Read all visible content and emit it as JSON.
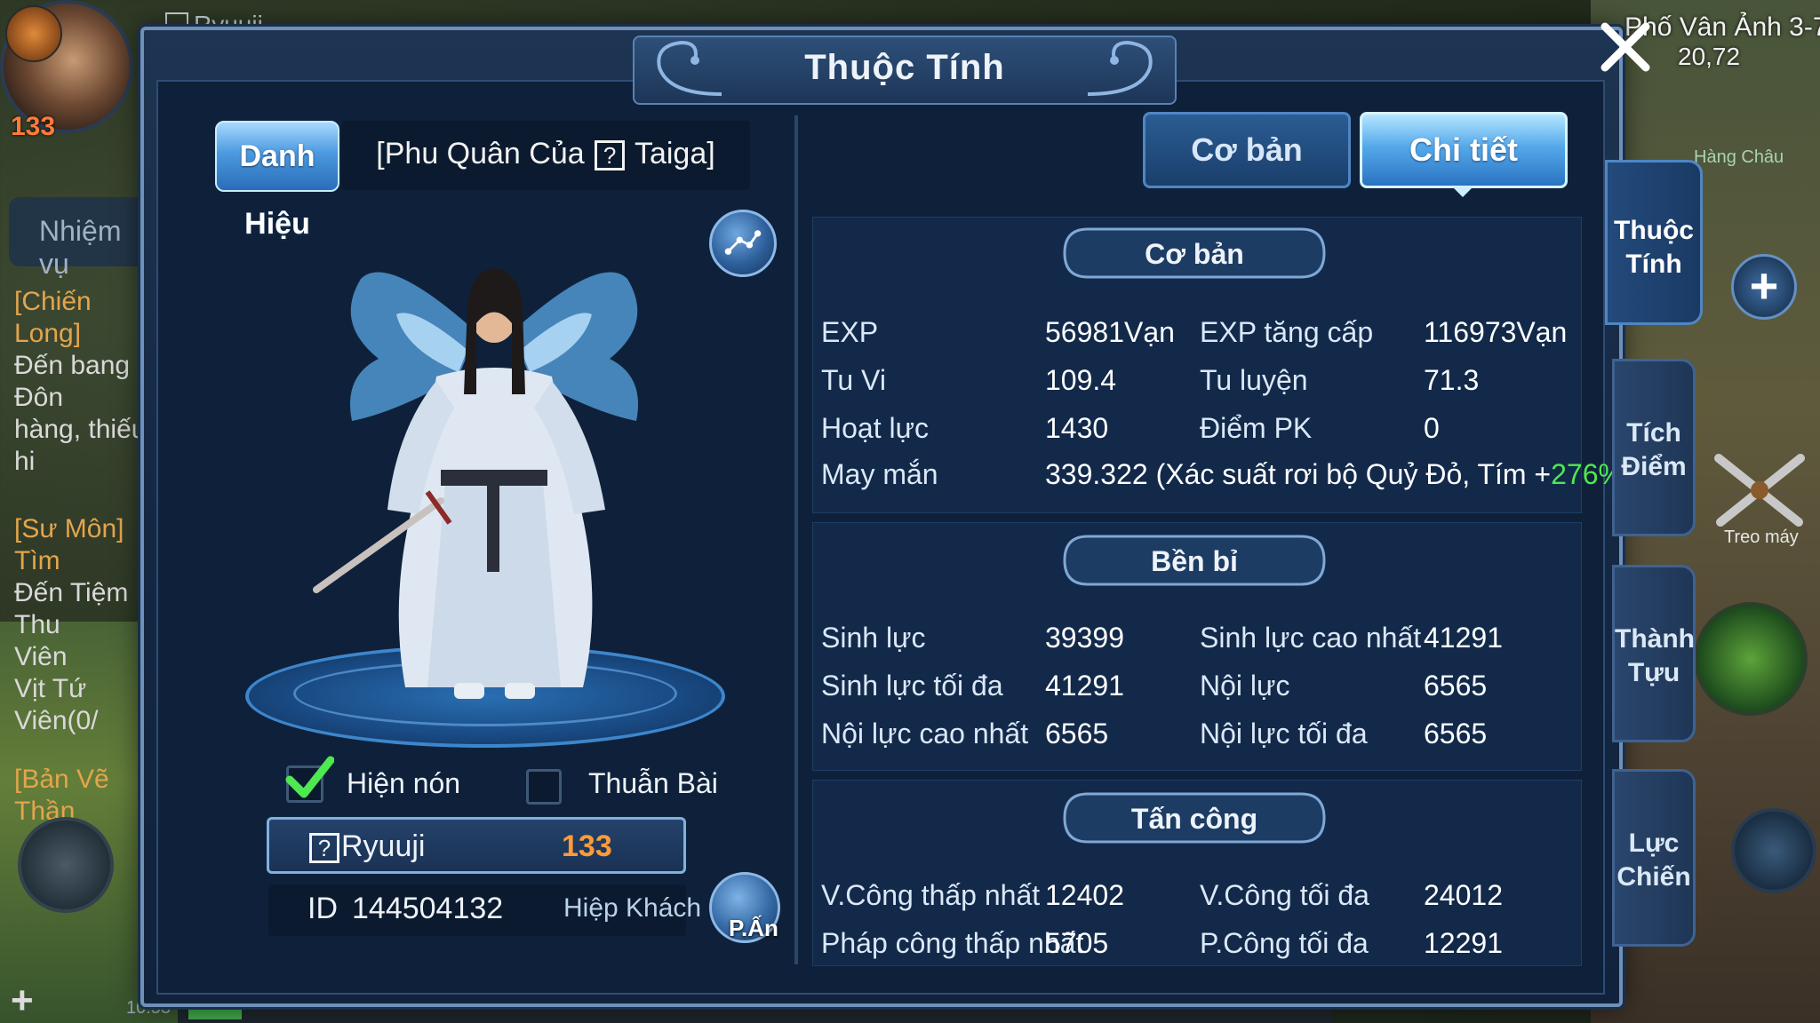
{
  "hud": {
    "player_name": "Ryuuji",
    "player_level": "133",
    "quest_tab": "Nhiệm vụ",
    "quests": [
      {
        "title": "[Chiến Long]",
        "lines": [
          "Đến bang Đôn",
          "hàng, thiếu hi"
        ]
      },
      {
        "title": "[Sư Môn] Tìm",
        "lines": [
          "Đến Tiệm Thu",
          "Viên",
          "Vịt Tứ Viên(0/"
        ]
      },
      {
        "title": "[Bản Vẽ Thần",
        "lines": []
      }
    ],
    "map_name": "Phố Vân Ảnh 3-7",
    "map_coords": "20,72",
    "town_label": "Hàng Châu",
    "treo_may": "Treo máy",
    "clock": "10:53"
  },
  "dialog": {
    "title": "Thuộc Tính",
    "left": {
      "title_tag": "Danh Hiệu",
      "title_name_prefix": "[Phu Quân Của",
      "title_name_box": "?",
      "title_name_suffix": "Taiga]",
      "toggle_hat_label": "Hiện nón",
      "toggle_hat_checked": true,
      "toggle_shield_label": "Thuẫn Bài",
      "toggle_shield_checked": false,
      "name_box": "?",
      "name": "Ryuuji",
      "level": "133",
      "id_label": "ID",
      "id_value": "144504132",
      "class_name": "Hiệp Khách",
      "pan_label": "P.Ấn"
    },
    "tabs": {
      "basic": "Cơ bản",
      "detail": "Chi tiết",
      "active": "detail"
    },
    "sections": {
      "basic": {
        "header": "Cơ bản",
        "rows": [
          {
            "l1": "EXP",
            "v1": "56981Vạn",
            "l2": "EXP tăng cấp",
            "v2": "116973Vạn"
          },
          {
            "l1": "Tu Vi",
            "v1": "109.4",
            "l2": "Tu luyện",
            "v2": "71.3"
          },
          {
            "l1": "Hoạt lực",
            "v1": "1430",
            "l2": "Điểm PK",
            "v2": "0"
          }
        ],
        "luck_label": "May mắn",
        "luck_value": "339.322 (Xác suất rơi bộ Quỷ Đỏ, Tím +",
        "luck_bonus": "276%",
        "luck_close": ")"
      },
      "durability": {
        "header": "Bền bỉ",
        "rows": [
          {
            "l1": "Sinh lực",
            "v1": "39399",
            "l2": "Sinh lực cao nhất",
            "v2": "41291"
          },
          {
            "l1": "Sinh lực tối đa",
            "v1": "41291",
            "l2": "Nội lực",
            "v2": "6565"
          },
          {
            "l1": "Nội lực cao nhất",
            "v1": "6565",
            "l2": "Nội lực tối đa",
            "v2": "6565"
          }
        ]
      },
      "attack": {
        "header": "Tấn công",
        "rows": [
          {
            "l1": "V.Công thấp nhất",
            "v1": "12402",
            "l2": "V.Công tối đa",
            "v2": "24012"
          },
          {
            "l1": "Pháp công thấp nhất",
            "v1": "5705",
            "l2": "P.Công tối đa",
            "v2": "12291"
          }
        ]
      }
    },
    "side_tabs": [
      {
        "line1": "Thuộc",
        "line2": "Tính",
        "active": true
      },
      {
        "line1": "Tích",
        "line2": "Điểm",
        "active": false
      },
      {
        "line1": "Thành",
        "line2": "Tựu",
        "active": false
      },
      {
        "line1": "Lực",
        "line2": "Chiến",
        "active": false
      }
    ]
  },
  "colors": {
    "accent": "#55a9ea",
    "level": "#ff9b3a",
    "bonus": "#4ee84f",
    "panel": "#12294a"
  }
}
